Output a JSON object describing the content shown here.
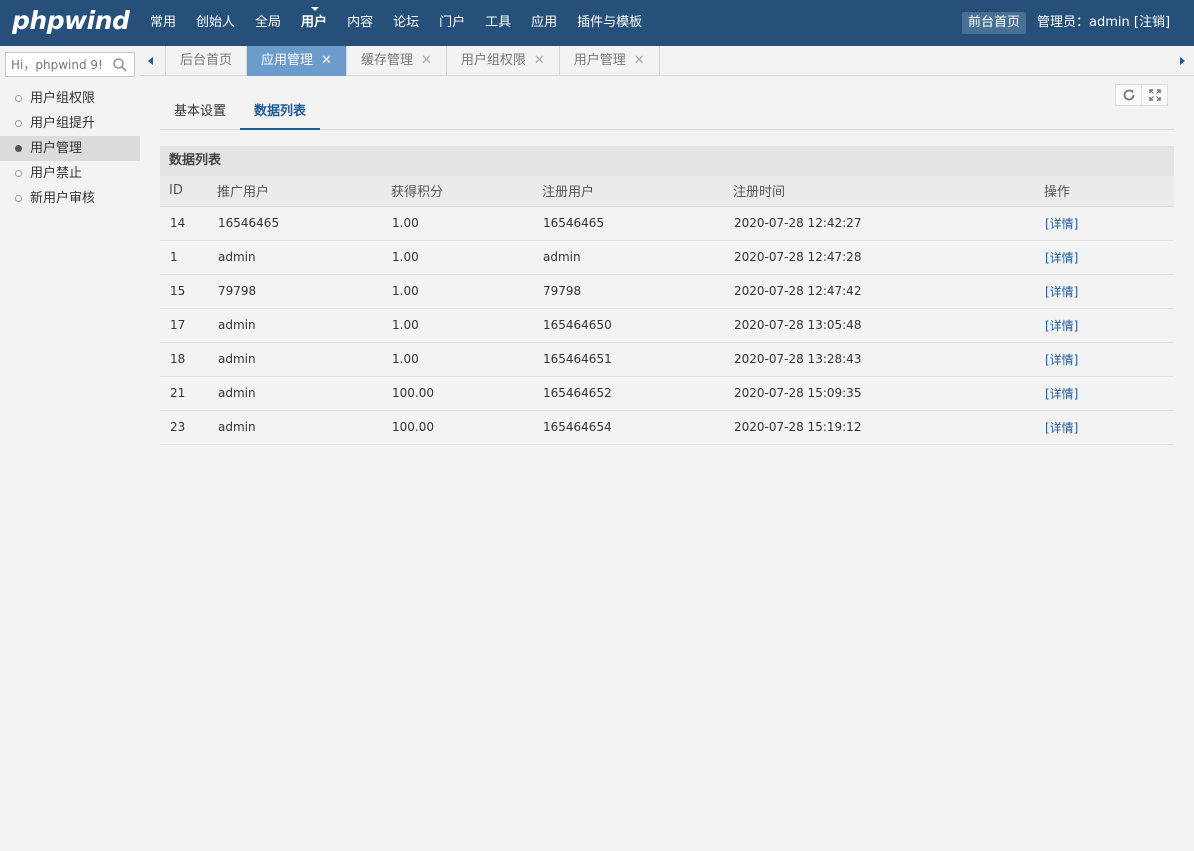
{
  "header": {
    "logo": "phpwind",
    "nav": [
      {
        "label": "常用"
      },
      {
        "label": "创始人"
      },
      {
        "label": "全局"
      },
      {
        "label": "用户"
      },
      {
        "label": "内容"
      },
      {
        "label": "论坛"
      },
      {
        "label": "门户"
      },
      {
        "label": "工具"
      },
      {
        "label": "应用"
      },
      {
        "label": "插件与模板"
      }
    ],
    "active_nav": "用户",
    "home_button": "前台首页",
    "admin_prefix": "管理员：admin",
    "logout_label": "[注销]"
  },
  "sidebar": {
    "search_placeholder": "Hi，phpwind 9!",
    "items": [
      {
        "label": "用户组权限"
      },
      {
        "label": "用户组提升"
      },
      {
        "label": "用户管理"
      },
      {
        "label": "用户禁止"
      },
      {
        "label": "新用户审核"
      }
    ],
    "active_item": "用户管理"
  },
  "tabs": [
    {
      "label": "后台首页",
      "closable": false
    },
    {
      "label": "应用管理",
      "closable": true
    },
    {
      "label": "缓存管理",
      "closable": true
    },
    {
      "label": "用户组权限",
      "closable": true
    },
    {
      "label": "用户管理",
      "closable": true
    }
  ],
  "active_tab": "应用管理",
  "subtabs": [
    {
      "label": "基本设置"
    },
    {
      "label": "数据列表"
    }
  ],
  "active_subtab": "数据列表",
  "panel": {
    "title": "数据列表",
    "columns": [
      "ID",
      "推广用户",
      "获得积分",
      "注册用户",
      "注册时间",
      "操作"
    ],
    "rows": [
      {
        "id": "14",
        "promoter": "16546465",
        "points": "1.00",
        "registered": "16546465",
        "time": "2020-07-28 12:42:27",
        "action": "[详情]"
      },
      {
        "id": "1",
        "promoter": "admin",
        "points": "1.00",
        "registered": "admin",
        "time": "2020-07-28 12:47:28",
        "action": "[详情]"
      },
      {
        "id": "15",
        "promoter": "79798",
        "points": "1.00",
        "registered": "79798",
        "time": "2020-07-28 12:47:42",
        "action": "[详情]"
      },
      {
        "id": "17",
        "promoter": "admin",
        "points": "1.00",
        "registered": "165464650",
        "time": "2020-07-28 13:05:48",
        "action": "[详情]"
      },
      {
        "id": "18",
        "promoter": "admin",
        "points": "1.00",
        "registered": "165464651",
        "time": "2020-07-28 13:28:43",
        "action": "[详情]"
      },
      {
        "id": "21",
        "promoter": "admin",
        "points": "100.00",
        "registered": "165464652",
        "time": "2020-07-28 15:09:35",
        "action": "[详情]"
      },
      {
        "id": "23",
        "promoter": "admin",
        "points": "100.00",
        "registered": "165464654",
        "time": "2020-07-28 15:19:12",
        "action": "[详情]"
      }
    ]
  },
  "icons": {
    "search": "search-icon",
    "refresh": "refresh-icon",
    "fullscreen": "fullscreen-icon",
    "close": "close-icon",
    "scroll_left": "chevron-left-icon",
    "scroll_right": "chevron-right-icon"
  },
  "colors": {
    "header_bg": "#26507a",
    "active_tab_bg": "#6c9ccc",
    "link": "#1f5c99"
  }
}
